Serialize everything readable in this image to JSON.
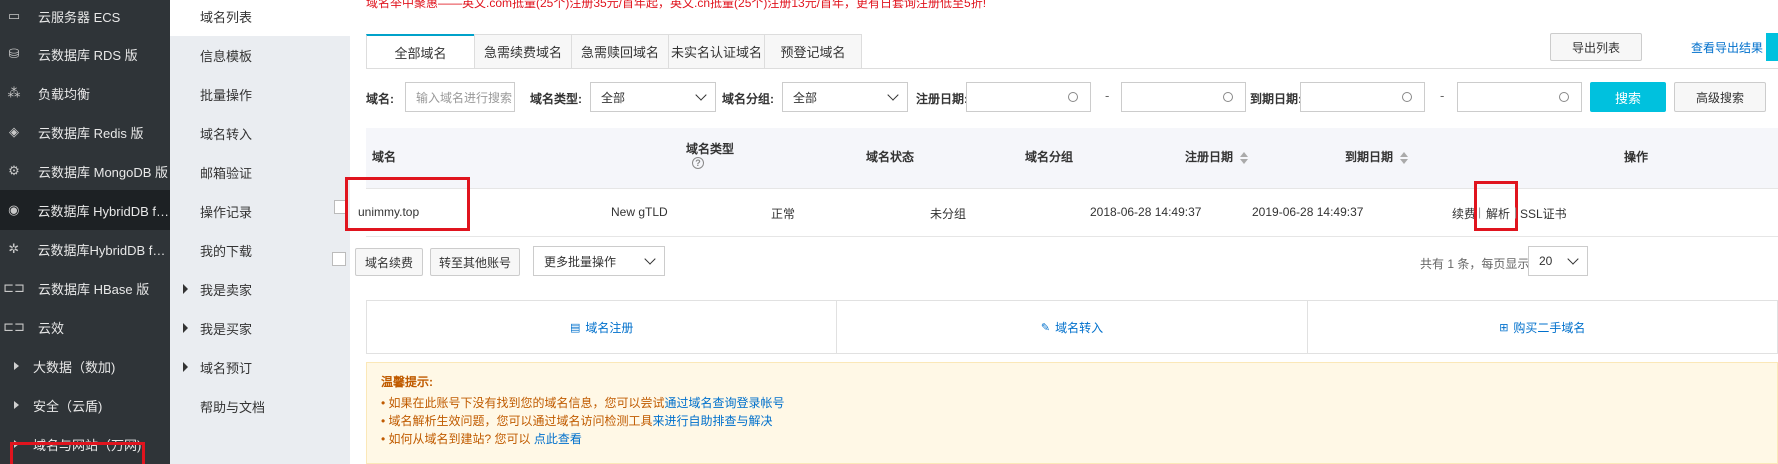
{
  "sidebar": {
    "items": [
      {
        "label": "云服务器 ECS",
        "icon": "server-icon"
      },
      {
        "label": "云数据库 RDS 版",
        "icon": "database-icon"
      },
      {
        "label": "负载均衡",
        "icon": "load-balancer-icon"
      },
      {
        "label": "云数据库 Redis 版",
        "icon": "redis-icon"
      },
      {
        "label": "云数据库 MongoDB 版",
        "icon": "mongodb-icon"
      },
      {
        "label": "云数据库 HybridDB fo...",
        "icon": "hybriddb-icon"
      },
      {
        "label": "云数据库HybridDB for...",
        "icon": "hybriddb-cluster-icon"
      },
      {
        "label": "云数据库 HBase 版",
        "icon": "hbase-icon"
      },
      {
        "label": "云效",
        "icon": "link-icon"
      }
    ],
    "groups": [
      {
        "label": "大数据（数加)"
      },
      {
        "label": "安全（云盾)"
      },
      {
        "label": "域名与网站（万网)"
      }
    ]
  },
  "subnav": {
    "items": [
      {
        "label": "域名列表"
      },
      {
        "label": "信息模板"
      },
      {
        "label": "批量操作"
      },
      {
        "label": "域名转入"
      },
      {
        "label": "邮箱验证"
      },
      {
        "label": "操作记录"
      },
      {
        "label": "我的下载"
      },
      {
        "label": "我是卖家"
      },
      {
        "label": "我是买家"
      },
      {
        "label": "域名预订"
      },
      {
        "label": "帮助与文档"
      }
    ]
  },
  "notice": "域名举中聚惠——英文.com抵量(25个)注册35元/首年起，英文.cn抵量(25个)注册13元/首年，更有日套询注册低至5折!",
  "tabs": [
    "全部域名",
    "急需续费域名",
    "急需赎回域名",
    "未实名认证域名",
    "预登记域名"
  ],
  "toolbar": {
    "export_label": "导出列表",
    "view_export_label": "查看导出结果"
  },
  "filters": {
    "domain_label": "域名:",
    "domain_placeholder": "输入域名进行搜索",
    "type_label": "域名类型:",
    "type_value": "全部",
    "group_label": "域名分组:",
    "group_value": "全部",
    "reg_date_label": "注册日期:",
    "exp_date_label": "到期日期:",
    "dash": "-",
    "search_label": "搜索",
    "advanced_label": "高级搜索"
  },
  "table": {
    "headers": {
      "domain": "域名",
      "type": "域名类型",
      "status": "域名状态",
      "group": "域名分组",
      "reg_date": "注册日期",
      "exp_date": "到期日期",
      "actions": "操作"
    },
    "help_glyph": "?",
    "rows": [
      {
        "domain": "unimmy.top",
        "type": "New gTLD",
        "status": "正常",
        "group": "未分组",
        "reg_date": "2018-06-28 14:49:37",
        "exp_date": "2019-06-28 14:49:37",
        "action_renew": "续费",
        "action_resolve": "解析",
        "action_ssl": "SSL证书",
        "separator": "|"
      }
    ]
  },
  "batch": {
    "renew_label": "域名续费",
    "transfer_label": "转至其他账号",
    "more_label": "更多批量操作"
  },
  "pager": {
    "summary": "共有 1 条，每页显示:",
    "page_size": "20"
  },
  "quick_actions": [
    {
      "label": "域名注册",
      "icon": "calendar-icon"
    },
    {
      "label": "域名转入",
      "icon": "pencil-icon"
    },
    {
      "label": "购买二手域名",
      "icon": "cart-icon"
    }
  ],
  "tips": {
    "title": "温馨提示:",
    "line1_text": "• 如果在此账号下没有找到您的域名信息，您可以尝试",
    "line1_link": "通过域名查询登录帐号",
    "line2_text": "• 域名解析生效问题，您可以通过域名访问检测工具",
    "line2_link": "来进行自助排查与解决",
    "line3_text": "• 如何从域名到建站? 您可以 ",
    "line3_link": "点此查看"
  },
  "colors": {
    "accent": "#00c1de",
    "link": "#0070cc",
    "highlight": "#e0141e",
    "sidebar": "#2f3438"
  }
}
